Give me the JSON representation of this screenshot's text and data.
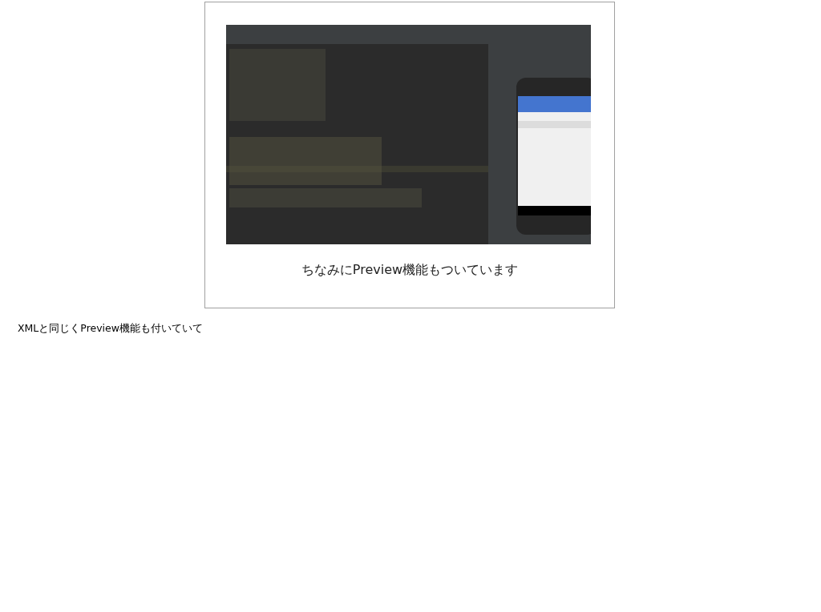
{
  "slide": {
    "caption": "ちなみにPreview機能もついています"
  },
  "notes": "XMLと同じくPreview機能も付いていて"
}
